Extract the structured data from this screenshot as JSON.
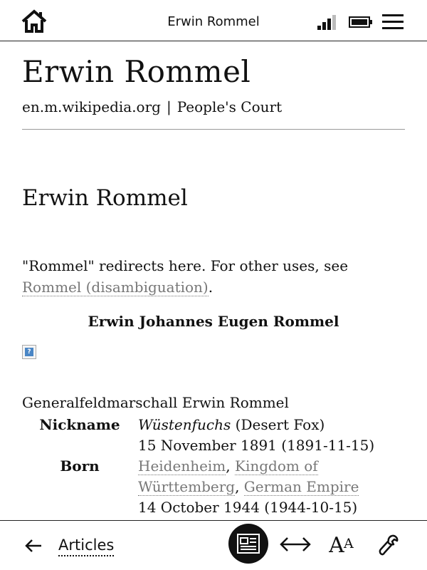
{
  "topbar": {
    "title": "Erwin Rommel",
    "icons": [
      "home-icon",
      "signal-icon",
      "battery-icon",
      "menu-icon"
    ]
  },
  "article": {
    "title": "Erwin Rommel",
    "source": "en.m.wikipedia.org",
    "separator": "|",
    "category": "People's Court",
    "section_heading": "Erwin Rommel",
    "hatnote_prefix": "\"Rommel\" redirects here. For other uses, see ",
    "hatnote_link": "Rommel (disambiguation)",
    "hatnote_suffix": ".",
    "infobox_title": "Erwin Johannes Eugen Rommel",
    "image_icon": "broken-image-icon",
    "caption": "Generalfeldmarschall Erwin Rommel"
  },
  "infobox": {
    "nickname_label": "Nickname",
    "nickname_italic": "Wüstenfuchs",
    "nickname_rest": " (Desert Fox)",
    "born_date": "15 November 1891 (1891-11-15)",
    "born_label": "Born",
    "born_place_1": "Heidenheim",
    "born_comma_1": ", ",
    "born_place_2": "Kingdom of Württemberg",
    "born_comma_2": ", ",
    "born_place_3": "German Empire",
    "died_date": "14 October 1944 (1944-10-15)"
  },
  "bottombar": {
    "back_icon": "arrow-left-icon",
    "articles_label": "Articles",
    "icons": [
      "reader-view-icon",
      "fit-width-icon",
      "font-size-icon",
      "wrench-icon"
    ]
  }
}
